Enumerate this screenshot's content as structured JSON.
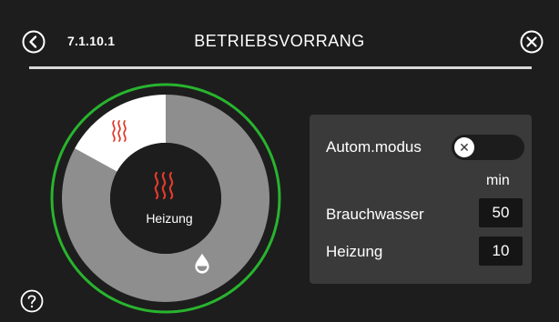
{
  "header": {
    "back_icon": "back-icon",
    "breadcrumb": "7.1.10.1",
    "title": "BETRIEBSVORRANG",
    "close_icon": "close-icon"
  },
  "dial": {
    "center_label": "Heizung",
    "heating_share": 0.17,
    "hot_water_share": 0.83,
    "heating_icon": "heat-icon",
    "hot_water_icon": "water-drop-icon"
  },
  "settings": {
    "auto_mode_label": "Autom.modus",
    "auto_mode_toggle_symbol": "✕",
    "unit": "min",
    "hot_water_label": "Brauchwasser",
    "hot_water_value": "50",
    "heating_label": "Heizung",
    "heating_value": "10"
  },
  "footer": {
    "help_icon": "help-icon"
  },
  "colors": {
    "background": "#1d1d1d",
    "panel": "#3a3a3a",
    "ring_green": "#28b42e",
    "ring_gray": "#8e8e8e",
    "heat_red": "#e03a2c",
    "active_segment": "#ffffff"
  }
}
